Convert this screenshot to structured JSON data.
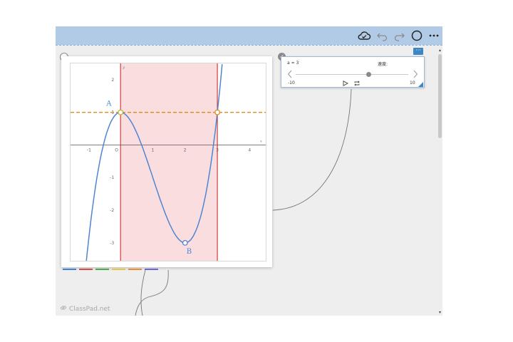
{
  "toolbar": {
    "icons": [
      "cloud-sync-icon",
      "undo-icon",
      "redo-icon",
      "circle-icon",
      "more-icon"
    ]
  },
  "graph": {
    "point_a_label": "A",
    "point_b_label": "B",
    "x_axis_label": "x",
    "y_axis_label": "y",
    "origin_label": "O",
    "x_ticks": [
      "-1",
      "1",
      "2",
      "3",
      "4"
    ],
    "y_ticks": [
      "2",
      "1",
      "-1",
      "-2",
      "-3"
    ],
    "colors": {
      "curve": "#4f86d1",
      "dashed_line": "#e08a1c",
      "region_fill": "#f9d9dc",
      "region_border": "#d13c3c",
      "point_a": "#c8c832",
      "point_b": "#5b7fcf"
    }
  },
  "slider": {
    "label": "a = 3",
    "speed_label": "速度:",
    "min": "-10",
    "max": "10",
    "value": 3,
    "knob_fraction": 0.65
  },
  "swatches": [
    "#3f82d2",
    "#d54a4a",
    "#48a948",
    "#e2c83a",
    "#e98b2f",
    "#6a64d6"
  ],
  "watermark": "ClassPad.net"
}
